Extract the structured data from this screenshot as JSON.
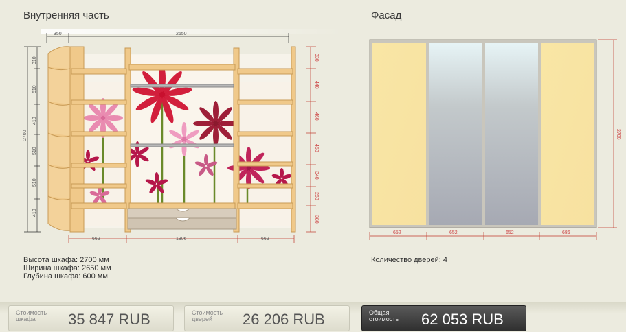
{
  "interior": {
    "title": "Внутренняя часть",
    "dims_top": [
      "350",
      "2650"
    ],
    "dims_left": [
      "310",
      "510",
      "410",
      "510",
      "510",
      "410"
    ],
    "dims_height": "2700",
    "dims_right": [
      "330",
      "440",
      "460",
      "450",
      "340",
      "260",
      "380"
    ],
    "dims_bottom": [
      "669",
      "1306",
      "669"
    ],
    "info": {
      "height": "Высота шкафа: 2700 мм",
      "width": "Ширина шкафа: 2650 мм",
      "depth": "Глубина шкафа: 600 мм"
    }
  },
  "facade": {
    "title": "Фасад",
    "dims_bottom": [
      "652",
      "652",
      "652",
      "686"
    ],
    "dims_height": "2700",
    "info": {
      "doors": "Количество дверей: 4"
    }
  },
  "costs": {
    "cabinet": {
      "label": "Стоимость шкафа",
      "value": "35 847  RUB"
    },
    "doors": {
      "label": "Стоимость дверей",
      "value": "26 206  RUB"
    },
    "total": {
      "label": "Общая стоимость",
      "value": "62 053  RUB"
    }
  },
  "colors": {
    "wood": "#f0c98a",
    "door_yellow": "#f8e6a6",
    "mirror": "#b9bec2",
    "dim_red": "#c0392b"
  }
}
